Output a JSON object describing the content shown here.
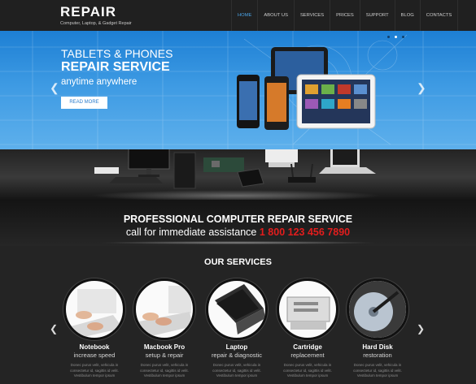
{
  "header": {
    "logo": "REPAIR",
    "tagline": "Computer, Laptop, & Gadget Repair",
    "nav": [
      "HOME",
      "ABOUT US",
      "SERVICES",
      "PRICES",
      "SUPPORT",
      "BLOG",
      "CONTACTS"
    ],
    "active_nav": "HOME"
  },
  "hero": {
    "line1": "TABLETS & PHONES",
    "line2": "REPAIR SERVICE",
    "line3": "anytime anywhere",
    "button": "READ MORE"
  },
  "banner": {
    "title": "PROFESSIONAL COMPUTER REPAIR SERVICE",
    "subtitle": "call for immediate assistance",
    "phone": "1 800 123 456 7890"
  },
  "services": {
    "title": "OUR SERVICES",
    "items": [
      {
        "title": "Notebook",
        "subtitle": "increase speed",
        "text": "Donec purus velit, vehicula in consectetur id, sagittis id velit. Vestibulum tempor ipsum"
      },
      {
        "title": "Macbook Pro",
        "subtitle": "setup & repair",
        "text": "Donec purus velit, vehicula in consectetur id, sagittis id velit. Vestibulum tempor ipsum"
      },
      {
        "title": "Laptop",
        "subtitle": "repair & diagnostic",
        "text": "Donec purus velit, vehicula in consectetur id, sagittis id velit. Vestibulum tempor ipsum"
      },
      {
        "title": "Cartridge",
        "subtitle": "replacement",
        "text": "Donec purus velit, vehicula in consectetur id, sagittis id velit. Vestibulum tempor ipsum"
      },
      {
        "title": "Hard Disk",
        "subtitle": "restoration",
        "text": "Donec purus velit, vehicula in consectetur id, sagittis id velit. Vestibulum tempor ipsum"
      }
    ]
  },
  "colors": {
    "accent": "#4aa3e6",
    "phone": "#e21d1d",
    "hero_top": "#1d7fd4"
  },
  "icons": [
    "chevron-left-icon",
    "chevron-right-icon"
  ]
}
